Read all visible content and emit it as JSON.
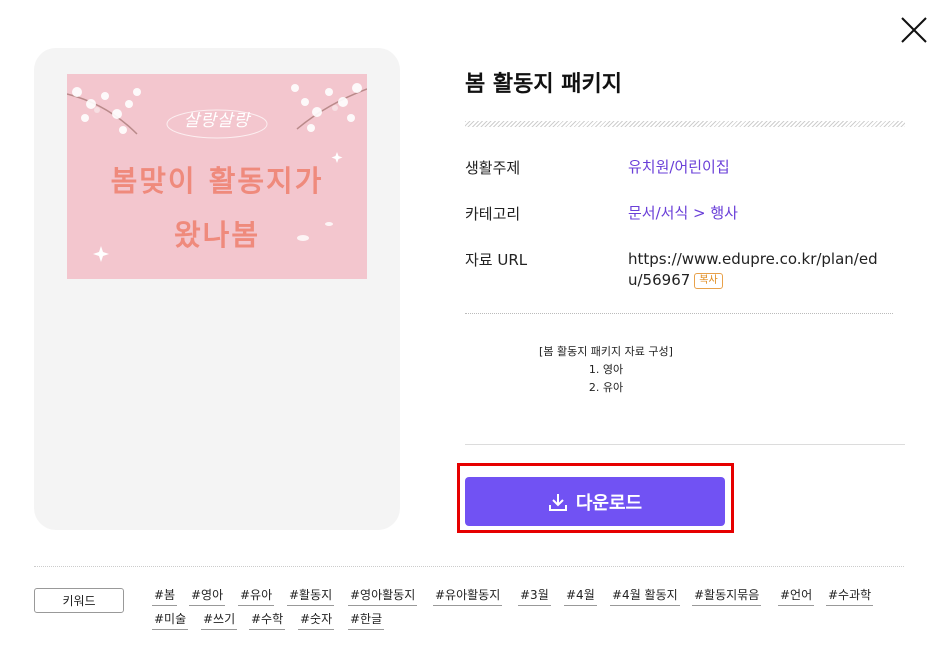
{
  "title": "봄 활동지 패키지",
  "thumbnail": {
    "subtitle": "살랑살랑",
    "line1": "봄맞이 활동지가",
    "line2": "왔나봄"
  },
  "info": {
    "theme_label": "생활주제",
    "theme_value": "유치원/어린이집",
    "category_label": "카테고리",
    "category_value": "문서/서식 > 행사",
    "url_label": "자료 URL",
    "url_value": "https://www.edupre.co.kr/plan/edu/56967",
    "copy_label": "복사"
  },
  "description": {
    "heading": "[봄 활동지 패키지 자료 구성]",
    "items": [
      "1. 영아",
      "2. 유아"
    ]
  },
  "download_label": "다운로드",
  "keyword_label": "키워드",
  "tags": [
    "#봄",
    "#영아",
    "#유아",
    "#활동지",
    "#영아활동지",
    "#유아활동지",
    "#3월",
    "#4월",
    "#4월 활동지",
    "#활동지묶음",
    "#언어",
    "#수과학",
    "#미술",
    "#쓰기",
    "#수학",
    "#숫자",
    "#한글"
  ],
  "colors": {
    "accent": "#7152f3",
    "link": "#6a3fd8",
    "highlight": "#e60000",
    "thumbnail_bg": "#f3c6ce",
    "thumbnail_text": "#ef8a7c"
  }
}
